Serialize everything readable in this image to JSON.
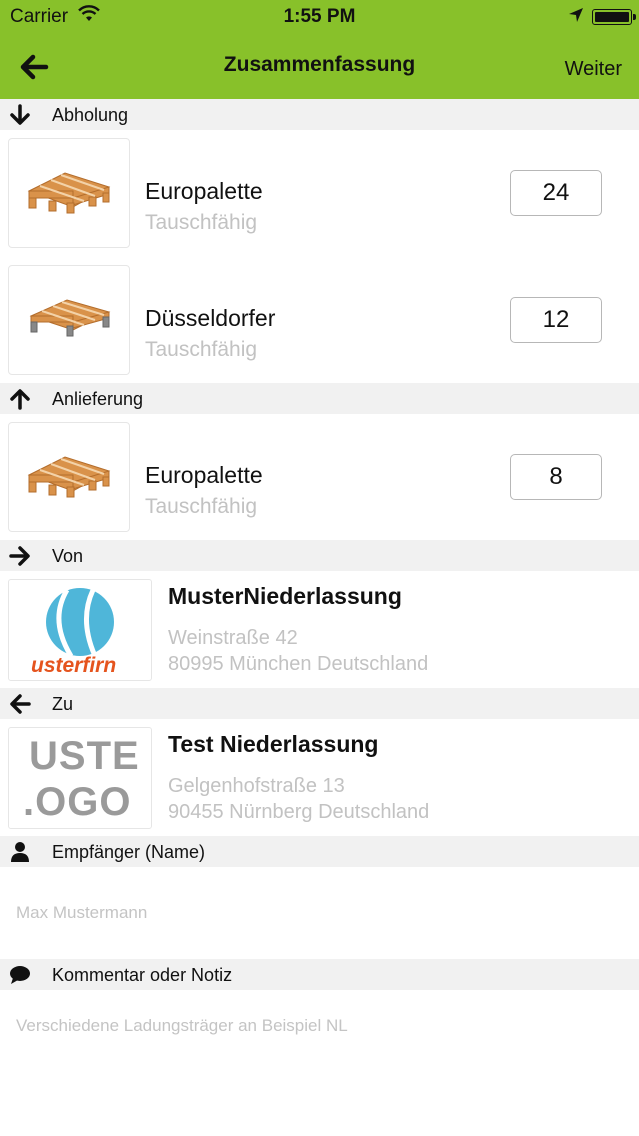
{
  "status_bar": {
    "carrier": "Carrier",
    "time": "1:55 PM"
  },
  "nav": {
    "title": "Zusammenfassung",
    "next_label": "Weiter"
  },
  "colors": {
    "header_green": "#88c12a",
    "section_bg": "#f1f1f1",
    "muted_text": "#c2c2c2",
    "pallet_wood": "#d9924a"
  },
  "sections": {
    "pickup": {
      "label": "Abholung",
      "icon": "arrow-down-icon"
    },
    "delivery": {
      "label": "Anlieferung",
      "icon": "arrow-up-icon"
    },
    "from": {
      "label": "Von",
      "icon": "arrow-right-icon"
    },
    "to": {
      "label": "Zu",
      "icon": "arrow-left-icon"
    },
    "recipient": {
      "label": "Empfänger (Name)",
      "icon": "person-icon"
    },
    "comment": {
      "label": "Kommentar oder Notiz",
      "icon": "speech-bubble-icon"
    }
  },
  "pickup_items": [
    {
      "name": "Europalette",
      "sub": "Tauschfähig",
      "qty": "24"
    },
    {
      "name": "Düsseldorfer",
      "sub": "Tauschfähig",
      "qty": "12"
    }
  ],
  "delivery_items": [
    {
      "name": "Europalette",
      "sub": "Tauschfähig",
      "qty": "8"
    }
  ],
  "from": {
    "name": "MusterNiederlassung",
    "street": "Weinstraße 42",
    "city": "80995 München Deutschland",
    "logo_text": "usterfirn"
  },
  "to": {
    "name": "Test Niederlassung",
    "street": "Gelgenhofstraße 13",
    "city": "90455 Nürnberg Deutschland",
    "logo_text_1": "USTE",
    "logo_text_2": ".OGO"
  },
  "recipient": {
    "placeholder": "Max Mustermann"
  },
  "comment": {
    "placeholder": "Verschiedene Ladungsträger an Beispiel NL"
  }
}
